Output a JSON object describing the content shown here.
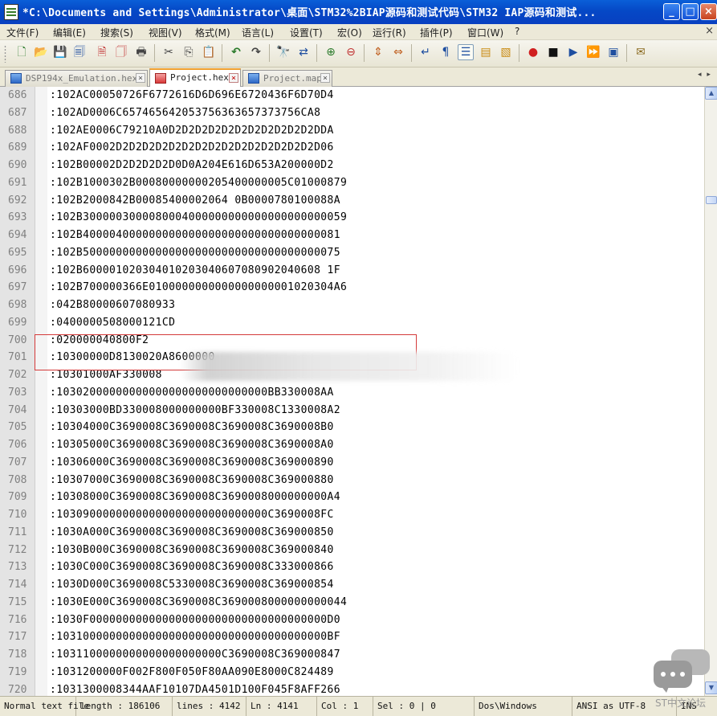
{
  "window": {
    "title": "*C:\\Documents and Settings\\Administrator\\桌面\\STM32%2BIAP源码和测试代码\\STM32 IAP源码和测试...",
    "min_label": "_",
    "max_label": "□",
    "close_label": "×"
  },
  "menu": {
    "items": [
      "文件(F)",
      "编辑(E)",
      "搜索(S)",
      "视图(V)",
      "格式(M)",
      "语言(L)",
      "设置(T)",
      "宏(O)",
      "运行(R)",
      "插件(P)",
      "窗口(W)",
      "?"
    ],
    "close_label": "×"
  },
  "toolbar": {
    "buttons": [
      {
        "name": "new-file-icon",
        "glyph": "🗋"
      },
      {
        "name": "open-file-icon",
        "glyph": "📂"
      },
      {
        "name": "save-icon",
        "glyph": "💾"
      },
      {
        "name": "save-all-icon",
        "glyph": "🗐"
      },
      {
        "name": "close-file-icon",
        "glyph": "🗎"
      },
      {
        "name": "close-all-icon",
        "glyph": "🗍"
      },
      {
        "name": "print-icon",
        "glyph": "🖶"
      },
      {
        "name": "cut-icon",
        "glyph": "✂"
      },
      {
        "name": "copy-icon",
        "glyph": "⎘"
      },
      {
        "name": "paste-icon",
        "glyph": "📋"
      },
      {
        "name": "undo-icon",
        "glyph": "↶"
      },
      {
        "name": "redo-icon",
        "glyph": "↷"
      },
      {
        "name": "find-icon",
        "glyph": "🔭"
      },
      {
        "name": "replace-icon",
        "glyph": "⇄"
      },
      {
        "name": "zoom-in-icon",
        "glyph": "⊕"
      },
      {
        "name": "zoom-out-icon",
        "glyph": "⊖"
      },
      {
        "name": "sync-vertical-icon",
        "glyph": "⇕"
      },
      {
        "name": "sync-horizontal-icon",
        "glyph": "⇔"
      },
      {
        "name": "word-wrap-icon",
        "glyph": "↵"
      },
      {
        "name": "show-all-chars-icon",
        "glyph": "¶"
      },
      {
        "name": "indent-guide-icon",
        "glyph": "☰"
      },
      {
        "name": "user-language-icon",
        "glyph": "▤"
      },
      {
        "name": "doc-map-icon",
        "glyph": "▧"
      },
      {
        "name": "record-macro-icon",
        "glyph": "●"
      },
      {
        "name": "stop-record-icon",
        "glyph": "■"
      },
      {
        "name": "play-macro-icon",
        "glyph": "▶"
      },
      {
        "name": "play-multiple-icon",
        "glyph": "⏩"
      },
      {
        "name": "save-macro-icon",
        "glyph": "▣"
      },
      {
        "name": "spellcheck-icon",
        "glyph": "✉"
      }
    ]
  },
  "tabs": [
    {
      "label": "DSP194x_Emulation.hex",
      "close": "×",
      "active": false
    },
    {
      "label": "Project.hex",
      "close": "×",
      "active": true
    },
    {
      "label": "Project.map",
      "close": "×",
      "active": false
    }
  ],
  "tab_nav": "◂ ▸",
  "editor": {
    "lines": [
      {
        "num": "686",
        "text": ":102AC00050726F6772616D6D696E6720436F6D70D4"
      },
      {
        "num": "687",
        "text": ":102AD0006C657465642053756363657373756CA8"
      },
      {
        "num": "688",
        "text": ":102AE0006C79210A0D2D2D2D2D2D2D2D2D2D2D2DDA"
      },
      {
        "num": "689",
        "text": ":102AF0002D2D2D2D2D2D2D2D2D2D2D2D2D2D2D2D06"
      },
      {
        "num": "690",
        "text": ":102B00002D2D2D2D2D0D0A204E616D653A200000D2"
      },
      {
        "num": "691",
        "text": ":102B1000302B00080000000205400000005C01000879"
      },
      {
        "num": "692",
        "text": ":102B2000842B00085400002064 0B0000780100088A"
      },
      {
        "num": "693",
        "text": ":102B3000003000080004000000000000000000000059"
      },
      {
        "num": "694",
        "text": ":102B400004000000000000000000000000000000081"
      },
      {
        "num": "695",
        "text": ":102B500000000000000000000000000000000000075"
      },
      {
        "num": "696",
        "text": ":102B600001020304010203040607080902040608 1F"
      },
      {
        "num": "697",
        "text": ":102B700000366E0100000000000000000001020304A6"
      },
      {
        "num": "698",
        "text": ":042B80000607080933"
      },
      {
        "num": "699",
        "text": ":0400000508000121CD"
      },
      {
        "num": "700",
        "text": ":020000040800F2"
      },
      {
        "num": "701",
        "text": ":10300000D8130020A8600000"
      },
      {
        "num": "702",
        "text": ":10301000AF330008"
      },
      {
        "num": "703",
        "text": ":10302000000000000000000000000000BB330008AA"
      },
      {
        "num": "704",
        "text": ":10303000BD330008000000000BF330008C1330008A2"
      },
      {
        "num": "705",
        "text": ":10304000C3690008C3690008C3690008C3690008B0"
      },
      {
        "num": "706",
        "text": ":10305000C3690008C3690008C3690008C3690008A0"
      },
      {
        "num": "707",
        "text": ":10306000C3690008C3690008C3690008C369000890"
      },
      {
        "num": "708",
        "text": ":10307000C3690008C3690008C3690008C369000880"
      },
      {
        "num": "709",
        "text": ":10308000C3690008C3690008C3690008000000000A4"
      },
      {
        "num": "710",
        "text": ":10309000000000000000000000000000C3690008FC"
      },
      {
        "num": "711",
        "text": ":1030A000C3690008C3690008C3690008C369000850"
      },
      {
        "num": "712",
        "text": ":1030B000C3690008C3690008C3690008C369000840"
      },
      {
        "num": "713",
        "text": ":1030C000C3690008C3690008C3690008C333000866"
      },
      {
        "num": "714",
        "text": ":1030D000C3690008C5330008C3690008C369000854"
      },
      {
        "num": "715",
        "text": ":1030E000C3690008C3690008C3690008000000000044"
      },
      {
        "num": "716",
        "text": ":1030F000000000000000000000000000000000000D0"
      },
      {
        "num": "717",
        "text": ":10310000000000000000000000000000000000000BF"
      },
      {
        "num": "718",
        "text": ":1031100000000000000000000C3690008C369000847"
      },
      {
        "num": "719",
        "text": ":1031200000F002F800F050F80AA090E8000C824489"
      },
      {
        "num": "720",
        "text": ":1031300008344AAF10107DA4501D100F045F8AFF266"
      }
    ]
  },
  "scrollbar": {
    "up": "▲",
    "down": "▼"
  },
  "status": {
    "type": "Normal text file",
    "length": "length : 186106",
    "lines": "lines : 4142",
    "ln": "Ln : 4141",
    "col": "Col : 1",
    "sel": "Sel : 0 | 0",
    "eol": "Dos\\Windows",
    "encoding": "ANSI as UTF-8",
    "mode": "INS"
  },
  "watermark": {
    "text": "ST中文论坛"
  },
  "colors": {
    "highlight_border": "#d43a3a",
    "titlebar": "#0548c6"
  }
}
